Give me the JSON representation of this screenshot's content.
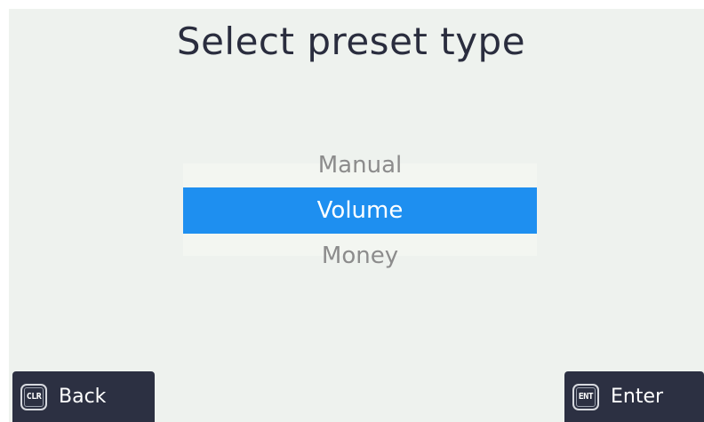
{
  "title": "Select preset type",
  "options": [
    {
      "label": "Manual",
      "selected": false
    },
    {
      "label": "Volume",
      "selected": true
    },
    {
      "label": "Money",
      "selected": false
    }
  ],
  "softkeys": {
    "back": {
      "key": "CLR",
      "label": "Back",
      "icon": "clr-key-icon"
    },
    "enter": {
      "key": "ENT",
      "label": "Enter",
      "icon": "ent-key-icon"
    }
  },
  "colors": {
    "background": "#eef2ee",
    "selection": "#1e8ff0",
    "title_text": "#2a2d3e",
    "unselected_text": "#8c8c8c",
    "softkey_background": "#2c3042"
  }
}
